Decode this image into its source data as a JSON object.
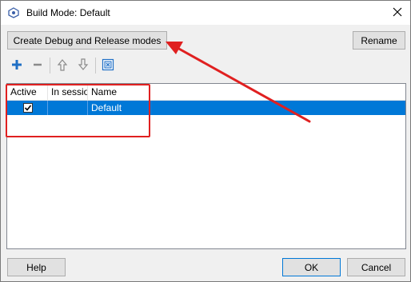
{
  "window": {
    "title": "Build Mode: Default"
  },
  "top_buttons": {
    "create_label": "Create Debug and Release modes",
    "rename_label": "Rename"
  },
  "toolbar": {
    "icons": [
      "add-icon",
      "remove-icon",
      "move-up-icon",
      "move-down-icon",
      "compare-icon"
    ]
  },
  "table": {
    "columns": [
      "Active",
      "In sessio",
      "Name"
    ],
    "rows": [
      {
        "active": true,
        "in_session": "",
        "name": "Default",
        "selected": true
      }
    ]
  },
  "bottom_buttons": {
    "help_label": "Help",
    "ok_label": "OK",
    "cancel_label": "Cancel"
  },
  "colors": {
    "selection": "#0078d7",
    "annotation": "#e02020",
    "toolbar_icon": "#1f6fc5"
  }
}
